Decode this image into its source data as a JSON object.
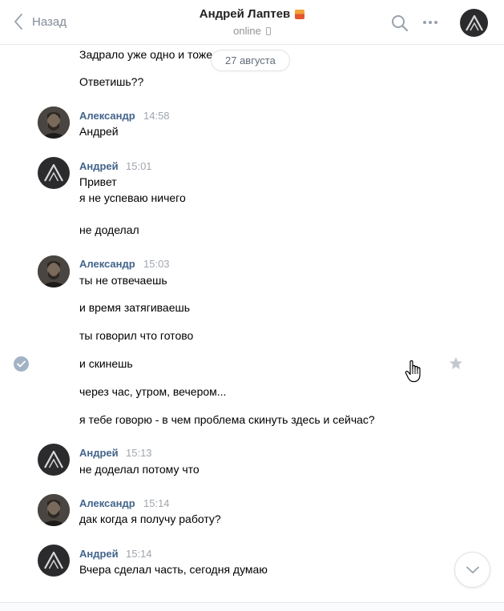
{
  "header": {
    "back_label": "Назад",
    "title": "Андрей Лаптев",
    "status": "online"
  },
  "date_divider": "27 августа",
  "messages": [
    {
      "lines": [
        "Задрало уже одно и тоже",
        "Ответишь??"
      ]
    },
    {
      "author": "Александр",
      "time": "14:58",
      "lines": [
        "Андрей"
      ]
    },
    {
      "author": "Андрей",
      "time": "15:01",
      "lines": [
        "Привет",
        "я не успеваю ничего",
        "не доделал"
      ]
    },
    {
      "author": "Александр",
      "time": "15:03",
      "lines": [
        "ты не отвечаешь",
        "и время затягиваешь",
        "ты говорил что готово",
        "и скинешь",
        "через час, утром, вечером...",
        "я тебе говорю - в чем проблема скинуть здесь и сейчас?"
      ]
    },
    {
      "author": "Андрей",
      "time": "15:13",
      "lines": [
        "не доделал потому что"
      ]
    },
    {
      "author": "Александр",
      "time": "15:14",
      "lines": [
        "дак когда я получу работу?"
      ]
    },
    {
      "author": "Андрей",
      "time": "15:14",
      "lines": [
        "Вчера сделал часть, сегодня думаю"
      ]
    }
  ],
  "colors": {
    "author_link": "#42648b",
    "time_gray": "#a0a6ae",
    "icon_gray": "#99a2ad",
    "selected_check": "#a3b3c6"
  }
}
